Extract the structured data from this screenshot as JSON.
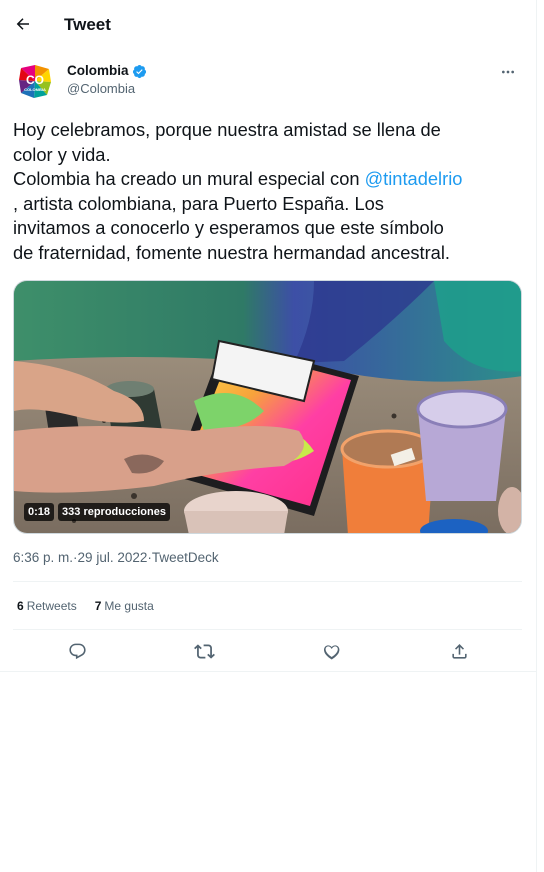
{
  "header": {
    "title": "Tweet",
    "back_icon": "arrow-left-icon"
  },
  "author": {
    "name": "Colombia",
    "handle": "@Colombia",
    "avatar_text": "CO",
    "avatar_subtext": "COLOMBIA",
    "verified_icon": "verified-badge-icon",
    "more_icon": "more-horizontal-icon"
  },
  "tweet": {
    "line1": "Hoy celebramos, porque nuestra amistad se llena de",
    "line2": "color y vida.",
    "line3_pre": "Colombia ha creado un mural especial con ",
    "mention": "@tintadelrio",
    "line4": ", artista colombiana, para Puerto España. Los",
    "line5": "invitamos a conocerlo y esperamos que este símbolo",
    "line6": "de fraternidad, fomente nuestra hermandad ancestral."
  },
  "media": {
    "duration": "0:18",
    "views": "333 reproducciones"
  },
  "meta": {
    "time": "6:36 p. m.",
    "separator": " · ",
    "date": "29 jul. 2022",
    "source": "TweetDeck"
  },
  "stats": {
    "retweets_count": "6",
    "retweets_label": "Retweets",
    "likes_count": "7",
    "likes_label": "Me gusta"
  },
  "actions": [
    "reply-icon",
    "retweet-icon",
    "like-icon",
    "share-icon"
  ],
  "colors": {
    "accent": "#1d9bf0",
    "text": "#0f1419",
    "muted": "#536471",
    "border": "#eff3f4"
  }
}
